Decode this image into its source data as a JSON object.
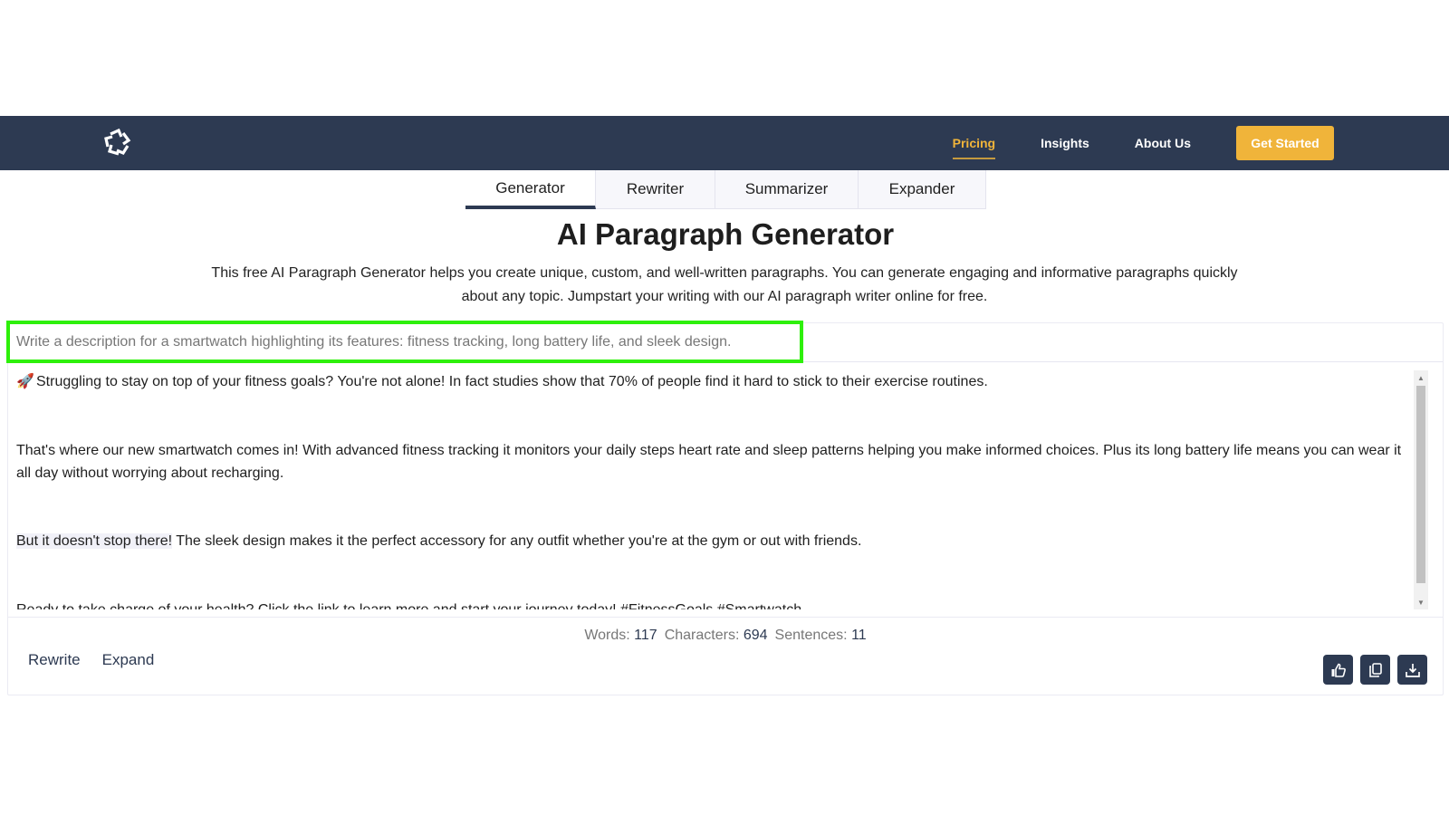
{
  "nav": {
    "logo": "logo-icon",
    "links": [
      {
        "label": "Pricing",
        "active": true
      },
      {
        "label": "Insights",
        "active": false
      },
      {
        "label": "About Us",
        "active": false
      }
    ],
    "cta": "Get Started",
    "accent_color": "#f0b43a",
    "bg_color": "#2d3a52"
  },
  "tabs": [
    {
      "label": "Generator",
      "active": true
    },
    {
      "label": "Rewriter",
      "active": false
    },
    {
      "label": "Summarizer",
      "active": false
    },
    {
      "label": "Expander",
      "active": false
    }
  ],
  "page": {
    "title": "AI Paragraph Generator",
    "intro": "This free AI Paragraph Generator helps you create unique, custom, and well-written paragraphs. You can generate engaging and informative paragraphs quickly about any topic. Jumpstart your writing with our AI paragraph writer online for free."
  },
  "prompt": {
    "value": "Write a description for a smartwatch highlighting its features: fitness tracking, long battery life, and sleek design.",
    "highlight_color": "#2ef00a"
  },
  "output": {
    "emoji": "🚀",
    "paragraphs": [
      "Struggling to stay on top of your fitness goals? You're not alone! In fact studies show that 70% of people find it hard to stick to their exercise routines.",
      "That's where our new smartwatch comes in! With advanced fitness tracking it monitors your daily steps heart rate and sleep patterns helping you make informed choices. Plus its long battery life means you can wear it all day without worrying about recharging.",
      "But it doesn't stop there!",
      " The sleek design makes it the perfect accessory for any outfit whether you're at the gym or out with friends.",
      "Ready to take charge of your health? Click the link to learn more and start your journey today! #FitnessGoals #Smartwatch"
    ]
  },
  "stats": {
    "words_label": "Words:",
    "words": "117",
    "characters_label": "Characters:",
    "characters": "694",
    "sentences_label": "Sentences:",
    "sentences": "11"
  },
  "actions": {
    "rewrite": "Rewrite",
    "expand": "Expand",
    "icons": [
      "thumbs-up-icon",
      "copy-icon",
      "download-icon"
    ]
  }
}
